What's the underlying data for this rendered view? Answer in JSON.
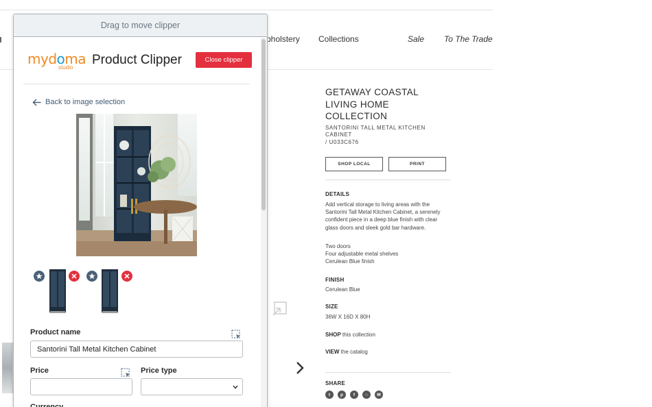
{
  "site": {
    "nav": [
      {
        "label": "pholstery",
        "italic": false
      },
      {
        "label": "Collections",
        "italic": false
      },
      {
        "label": "Sale",
        "italic": true
      },
      {
        "label": "To The Trade",
        "italic": true
      }
    ],
    "product": {
      "collection_title": "GETAWAY COASTAL LIVING HOME COLLECTION",
      "subtitle": "SANTORINI TALL METAL KITCHEN CABINET",
      "sku": "/ U033C676",
      "shop_local_label": "SHOP LOCAL",
      "print_label": "PRINT",
      "details_heading": "DETAILS",
      "details_text": "Add vertical storage to living areas with the Santorini Tall Metal Kitchen Cabinet, a serenely confident piece in a deep blue finish with clear glass doors and sleek gold bar hardware.",
      "features": [
        "Two doors",
        "Four adjustable metal shelves",
        "Cerulean Blue finish"
      ],
      "finish_heading": "FINISH",
      "finish_value": "Cerulean Blue",
      "size_heading": "SIZE",
      "size_value": "36W X 16D X 80H",
      "shop_bold": "SHOP",
      "shop_rest": " this collection",
      "view_bold": "VIEW",
      "view_rest": " the catalog",
      "share_heading": "SHARE",
      "share_icons": [
        "twitter-icon",
        "pinterest-icon",
        "facebook-icon",
        "instagram-icon",
        "email-icon"
      ]
    }
  },
  "clipper": {
    "drag_label": "Drag to move clipper",
    "logo_text": "mydoma",
    "logo_sub": "studio",
    "title": "Product Clipper",
    "close_label": "Close clipper",
    "back_label": "Back to image selection",
    "product_name_label": "Product name",
    "product_name_value": "Santorini Tall Metal Kitchen Cabinet",
    "price_label": "Price",
    "price_value": "",
    "price_type_label": "Price type",
    "price_type_value": "",
    "currency_label": "Currency"
  },
  "colors": {
    "accent_red": "#e4303e",
    "star_blue": "#4b6178",
    "logo_orange": "#f08a24",
    "logo_blue": "#1c9bd7"
  }
}
